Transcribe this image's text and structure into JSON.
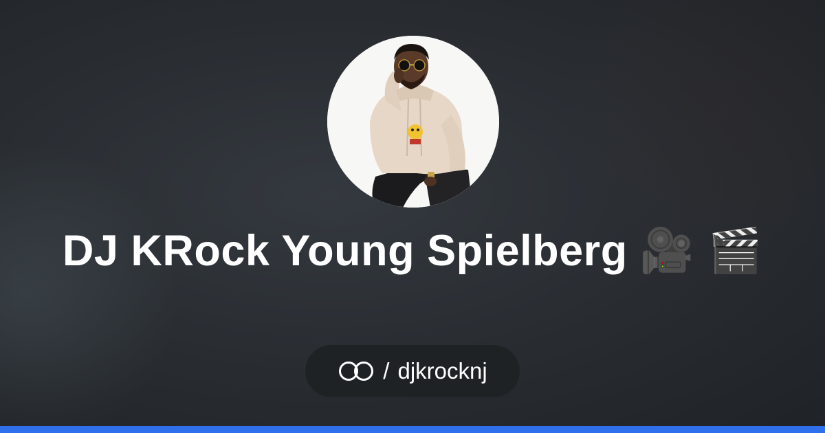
{
  "profile": {
    "display_name": "DJ KRock Young Spielberg",
    "title_emoji": "🎥 🎬",
    "separator": "/",
    "handle": "djkrocknj"
  },
  "icons": {
    "brand_logo": "linked-rings-icon",
    "avatar": "profile-photo"
  },
  "colors": {
    "background": "#2a2e33",
    "pill_background": "#1f2225",
    "accent_bar": "#2f6feb",
    "text": "#ffffff"
  }
}
